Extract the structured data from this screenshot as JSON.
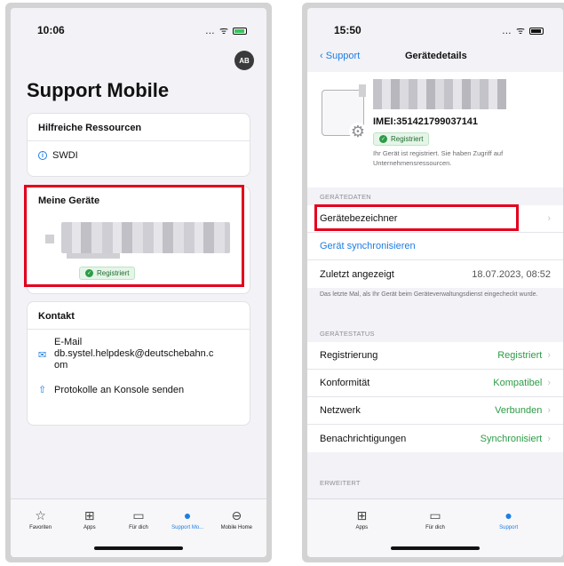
{
  "left": {
    "time": "10:06",
    "status_icons": "… ᯤ",
    "avatar": "AB",
    "title": "Support Mobile",
    "resources": {
      "title": "Hilfreiche Ressourcen",
      "item": "SWDI"
    },
    "devices": {
      "title": "Meine Geräte",
      "badge": "Registriert"
    },
    "contact": {
      "title": "Kontakt",
      "email_label": "E-Mail",
      "email": "db.systel.helpdesk@deutschebahn.c",
      "email_cont": "om",
      "send": "Protokolle an Konsole senden"
    },
    "tabs": [
      {
        "icon": "☆",
        "label": "Favoriten"
      },
      {
        "icon": "⊞",
        "label": "Apps"
      },
      {
        "icon": "▭",
        "label": "Für dich"
      },
      {
        "icon": "●",
        "label": "Support Mo..."
      },
      {
        "icon": "⊖",
        "label": "Mobile Home"
      }
    ]
  },
  "right": {
    "time": "15:50",
    "status_icons": "… ᯤ",
    "back": "Support",
    "title": "Gerätedetails",
    "imei": "IMEI:351421799037141",
    "badge": "Registriert",
    "reg_desc": "Ihr Gerät ist registriert. Sie haben Zugriff auf Unternehmensressourcen.",
    "section_data": "GERÄTEDATEN",
    "device_id": "Gerätebezeichner",
    "sync": "Gerät synchronisieren",
    "last_seen_label": "Zuletzt angezeigt",
    "last_seen_value": "18.07.2023, 08:52",
    "explain": "Das letzte Mal, als Ihr Gerät beim Geräteverwaltungsdienst eingecheckt wurde.",
    "section_status": "GERÄTESTATUS",
    "status_rows": [
      {
        "label": "Registrierung",
        "value": "Registriert"
      },
      {
        "label": "Konformität",
        "value": "Kompatibel"
      },
      {
        "label": "Netzwerk",
        "value": "Verbunden"
      },
      {
        "label": "Benachrichtigungen",
        "value": "Synchronisiert"
      }
    ],
    "section_ext": "ERWEITERT",
    "tabs": [
      {
        "icon": "⊞",
        "label": "Apps"
      },
      {
        "icon": "▭",
        "label": "Für dich"
      },
      {
        "icon": "●",
        "label": "Support"
      }
    ]
  }
}
